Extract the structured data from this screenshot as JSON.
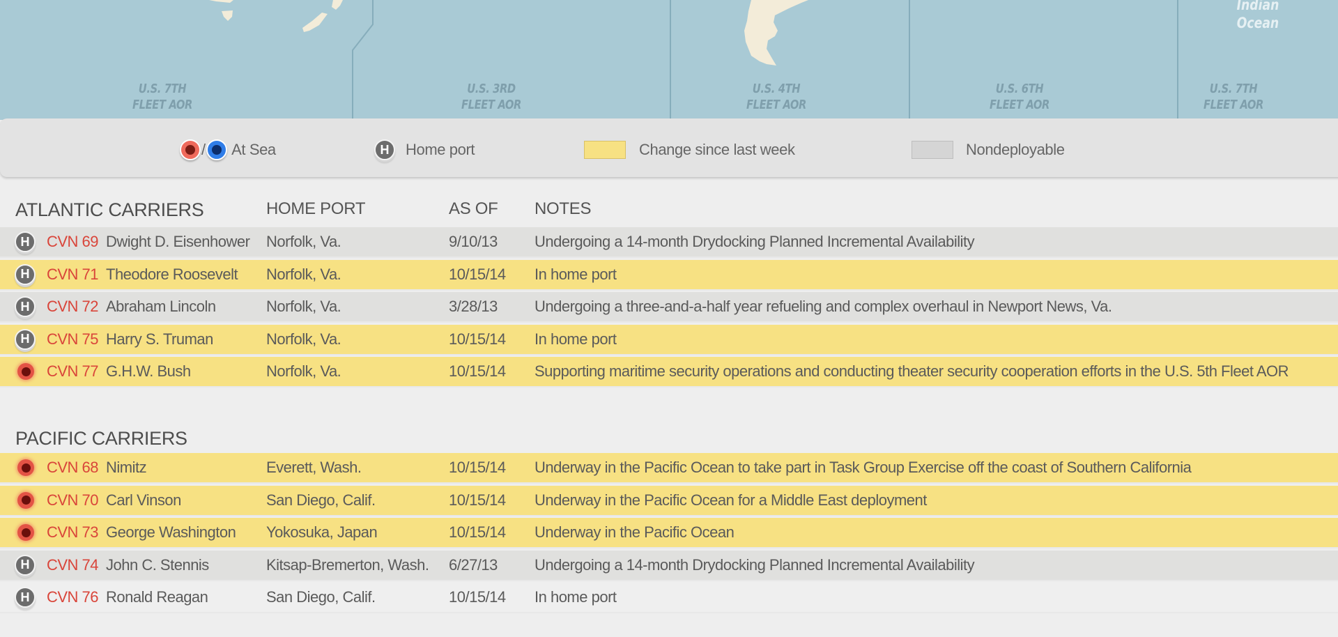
{
  "map": {
    "aor_labels": [
      {
        "line1": "U.S. 7TH",
        "line2": "FLEET AOR"
      },
      {
        "line1": "U.S. 3RD",
        "line2": "FLEET AOR"
      },
      {
        "line1": "U.S. 4TH",
        "line2": "FLEET AOR"
      },
      {
        "line1": "U.S. 6TH",
        "line2": "FLEET AOR"
      },
      {
        "line1": "U.S. 7TH",
        "line2": "FLEET AOR"
      }
    ],
    "ocean_label": {
      "line1": "Indian",
      "line2": "Ocean"
    },
    "colors": {
      "water": "#a9cad5",
      "land": "#f3ecd9",
      "boundary": "#86adbb"
    }
  },
  "legend": {
    "at_sea_label": "At Sea",
    "slash": "/",
    "home_port_label": "Home port",
    "home_port_icon_letter": "H",
    "change_label": "Change since last week",
    "nondeployable_label": "Nondeployable",
    "colors": {
      "at_sea_red": "#ef6a5c",
      "at_sea_blue": "#2f7de8",
      "change": "#f7e183",
      "nondeployable": "#d5d5d5"
    }
  },
  "atlantic": {
    "title": "ATLANTIC CARRIERS",
    "columns": {
      "home_port": "HOME PORT",
      "as_of": "AS OF",
      "notes": "NOTES"
    },
    "rows": [
      {
        "status": "home-port",
        "row_type": "nondeploy",
        "hull": "CVN 69",
        "name": "Dwight D. Eisenhower",
        "port": "Norfolk, Va.",
        "as_of": "9/10/13",
        "notes": "Undergoing a 14-month Drydocking Planned Incremental Availability"
      },
      {
        "status": "home-port",
        "row_type": "changed",
        "hull": "CVN 71",
        "name": "Theodore Roosevelt",
        "port": "Norfolk, Va.",
        "as_of": "10/15/14",
        "notes": "In home port"
      },
      {
        "status": "home-port",
        "row_type": "nondeploy",
        "hull": "CVN 72",
        "name": "Abraham Lincoln",
        "port": "Norfolk, Va.",
        "as_of": "3/28/13",
        "notes": "Undergoing a three-and-a-half year refueling and complex overhaul in Newport News, Va."
      },
      {
        "status": "home-port",
        "row_type": "changed",
        "hull": "CVN 75",
        "name": "Harry S. Truman",
        "port": "Norfolk, Va.",
        "as_of": "10/15/14",
        "notes": "In home port"
      },
      {
        "status": "at-sea",
        "row_type": "changed",
        "hull": "CVN 77",
        "name": "G.H.W. Bush",
        "port": "Norfolk, Va.",
        "as_of": "10/15/14",
        "notes": "Supporting maritime security operations and conducting theater security cooperation efforts in the U.S. 5th Fleet AOR"
      }
    ]
  },
  "pacific": {
    "title": "PACIFIC CARRIERS",
    "rows": [
      {
        "status": "at-sea",
        "row_type": "changed",
        "hull": "CVN 68",
        "name": "Nimitz",
        "port": "Everett, Wash.",
        "as_of": "10/15/14",
        "notes": "Underway in the Pacific Ocean to take part in Task Group Exercise off the coast of Southern California"
      },
      {
        "status": "at-sea",
        "row_type": "changed",
        "hull": "CVN 70",
        "name": "Carl Vinson",
        "port": "San Diego, Calif.",
        "as_of": "10/15/14",
        "notes": "Underway in the Pacific Ocean for a Middle East deployment"
      },
      {
        "status": "at-sea",
        "row_type": "changed",
        "hull": "CVN 73",
        "name": "George Washington",
        "port": "Yokosuka, Japan",
        "as_of": "10/15/14",
        "notes": "Underway in the Pacific Ocean"
      },
      {
        "status": "home-port",
        "row_type": "nondeploy",
        "hull": "CVN 74",
        "name": "John C. Stennis",
        "port": "Kitsap-Bremerton, Wash.",
        "as_of": "6/27/13",
        "notes": "Undergoing a 14-month Drydocking Planned Incremental Availability"
      },
      {
        "status": "home-port",
        "row_type": "plain",
        "hull": "CVN 76",
        "name": "Ronald Reagan",
        "port": "San Diego, Calif.",
        "as_of": "10/15/14",
        "notes": "In home port"
      }
    ]
  }
}
